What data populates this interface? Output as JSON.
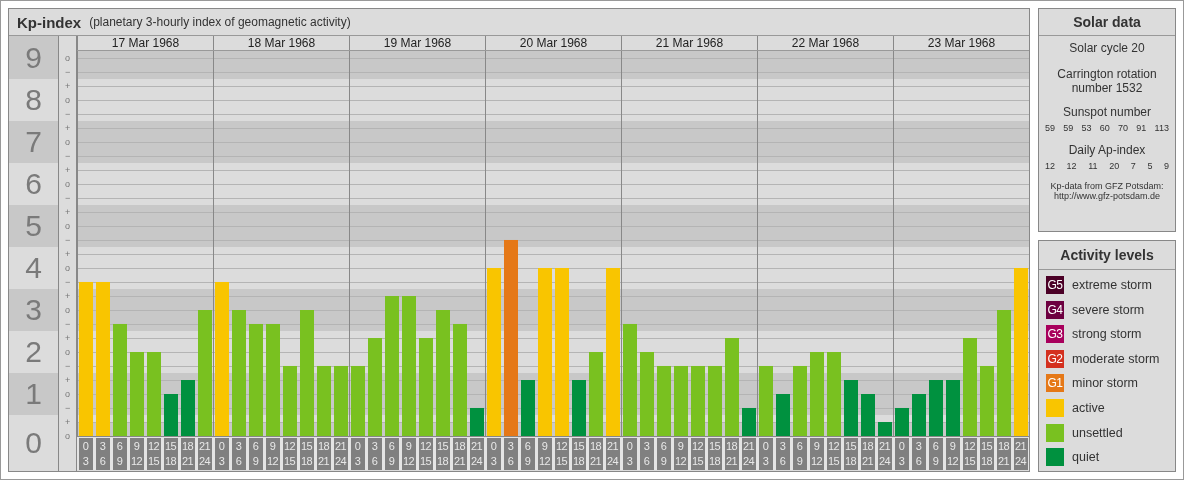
{
  "kp_chart": {
    "title": "Kp-index",
    "subtitle": "(planetary 3-hourly index of geomagnetic activity)",
    "days": [
      "17 Mar 1968",
      "18 Mar 1968",
      "19 Mar 1968",
      "20 Mar 1968",
      "21 Mar 1968",
      "22 Mar 1968",
      "23 Mar 1968"
    ],
    "scale_marks": [
      "o",
      "−",
      "+",
      "o",
      "−",
      "+",
      "o",
      "−",
      "+",
      "o",
      "−",
      "+",
      "o",
      "−",
      "+",
      "o",
      "−",
      "+",
      "o",
      "−",
      "+",
      "o",
      "−",
      "+",
      "o",
      "−",
      "+",
      "o"
    ],
    "chart_data": {
      "type": "bar",
      "grid": true,
      "ylim": [
        0,
        9
      ],
      "yticks": [
        {
          "value": 0,
          "label": "0"
        },
        {
          "value": 1,
          "label": "1"
        },
        {
          "value": 2,
          "label": "2"
        },
        {
          "value": 3,
          "label": "3"
        },
        {
          "value": 4,
          "label": "4"
        },
        {
          "value": 5,
          "label": "5"
        },
        {
          "value": 6,
          "label": "6"
        },
        {
          "value": 7,
          "label": "7"
        },
        {
          "value": 8,
          "label": "8"
        },
        {
          "value": 9,
          "label": "9"
        }
      ],
      "categories": [
        "0 3",
        "3 6",
        "6 9",
        "9 12",
        "12 15",
        "15 18",
        "18 21",
        "21 24",
        "0 3",
        "3 6",
        "6 9",
        "9 12",
        "12 15",
        "15 18",
        "18 21",
        "21 24",
        "0 3",
        "3 6",
        "6 9",
        "9 12",
        "12 15",
        "15 18",
        "18 21",
        "21 24",
        "0 3",
        "3 6",
        "6 9",
        "9 12",
        "12 15",
        "15 18",
        "18 21",
        "21 24",
        "0 3",
        "3 6",
        "6 9",
        "9 12",
        "12 15",
        "15 18",
        "18 21",
        "21 24",
        "0 3",
        "3 6",
        "6 9",
        "9 12",
        "12 15",
        "15 18",
        "18 21",
        "21 24",
        "0 3",
        "3 6",
        "6 9",
        "9 12",
        "12 15",
        "15 18",
        "18 21",
        "21 24"
      ],
      "series": [
        {
          "color": "#00913f",
          "values": [
            null,
            null,
            null,
            null,
            null,
            1,
            1.333,
            null,
            null,
            null,
            null,
            null,
            null,
            null,
            null,
            null,
            null,
            null,
            null,
            null,
            null,
            null,
            null,
            0.667,
            null,
            null,
            1.333,
            null,
            null,
            1.333,
            null,
            null,
            null,
            null,
            null,
            null,
            null,
            null,
            null,
            0.667,
            null,
            1,
            null,
            null,
            null,
            1.333,
            1,
            0.333,
            0.667,
            1,
            1.333,
            1.333,
            null,
            null,
            null,
            null
          ]
        },
        {
          "color": "#79c120",
          "values": [
            null,
            null,
            2.667,
            2,
            2,
            null,
            null,
            3,
            null,
            3,
            2.667,
            2.667,
            1.667,
            3,
            1.667,
            1.667,
            1.667,
            2.333,
            3.333,
            3.333,
            2.333,
            3,
            2.667,
            null,
            null,
            null,
            null,
            null,
            null,
            null,
            2,
            null,
            2.667,
            2,
            1.667,
            1.667,
            1.667,
            1.667,
            2.333,
            null,
            1.667,
            null,
            1.667,
            2,
            2,
            null,
            null,
            null,
            null,
            null,
            null,
            null,
            2.333,
            1.667,
            3,
            null
          ]
        },
        {
          "color": "#f9c500",
          "values": [
            3.667,
            3.667,
            null,
            null,
            null,
            null,
            null,
            null,
            3.667,
            null,
            null,
            null,
            null,
            null,
            null,
            null,
            null,
            null,
            null,
            null,
            null,
            null,
            null,
            null,
            4,
            null,
            null,
            4,
            4,
            null,
            null,
            4,
            null,
            null,
            null,
            null,
            null,
            null,
            null,
            null,
            null,
            null,
            null,
            null,
            null,
            null,
            null,
            null,
            null,
            null,
            null,
            null,
            null,
            null,
            null,
            4
          ]
        },
        {
          "color": "#e57817",
          "values": [
            null,
            null,
            null,
            null,
            null,
            null,
            null,
            null,
            null,
            null,
            null,
            null,
            null,
            null,
            null,
            null,
            null,
            null,
            null,
            null,
            null,
            null,
            null,
            null,
            null,
            4.667,
            null,
            null,
            null,
            null,
            null,
            null,
            null,
            null,
            null,
            null,
            null,
            null,
            null,
            null,
            null,
            null,
            null,
            null,
            null,
            null,
            null,
            null,
            null,
            null,
            null,
            null,
            null,
            null,
            null,
            null
          ]
        }
      ]
    }
  },
  "solar_data": {
    "title": "Solar data",
    "cycle": "Solar cycle 20",
    "rotation": "Carrington rotation number 1532",
    "sunspot_label": "Sunspot number",
    "sunspot_numbers": [
      "59",
      "59",
      "53",
      "60",
      "70",
      "91",
      "113"
    ],
    "ap_label": "Daily Ap-index",
    "ap_values": [
      "12",
      "12",
      "11",
      "20",
      "7",
      "5",
      "9"
    ],
    "credit": "Kp-data from GFZ Potsdam:",
    "credit_url": "http://www.gfz-potsdam.de"
  },
  "activity_levels": {
    "title": "Activity levels",
    "items": [
      {
        "badge": "G5",
        "label": "extreme storm",
        "color": "#4b0026"
      },
      {
        "badge": "G4",
        "label": "severe storm",
        "color": "#6d0040"
      },
      {
        "badge": "G3",
        "label": "strong storm",
        "color": "#a8005c"
      },
      {
        "badge": "G2",
        "label": "moderate storm",
        "color": "#d4301e"
      },
      {
        "badge": "G1",
        "label": "minor storm",
        "color": "#e57817"
      },
      {
        "label": "active",
        "color": "#f9c500"
      },
      {
        "label": "unsettled",
        "color": "#79c120"
      },
      {
        "label": "quiet",
        "color": "#00913f"
      }
    ]
  }
}
